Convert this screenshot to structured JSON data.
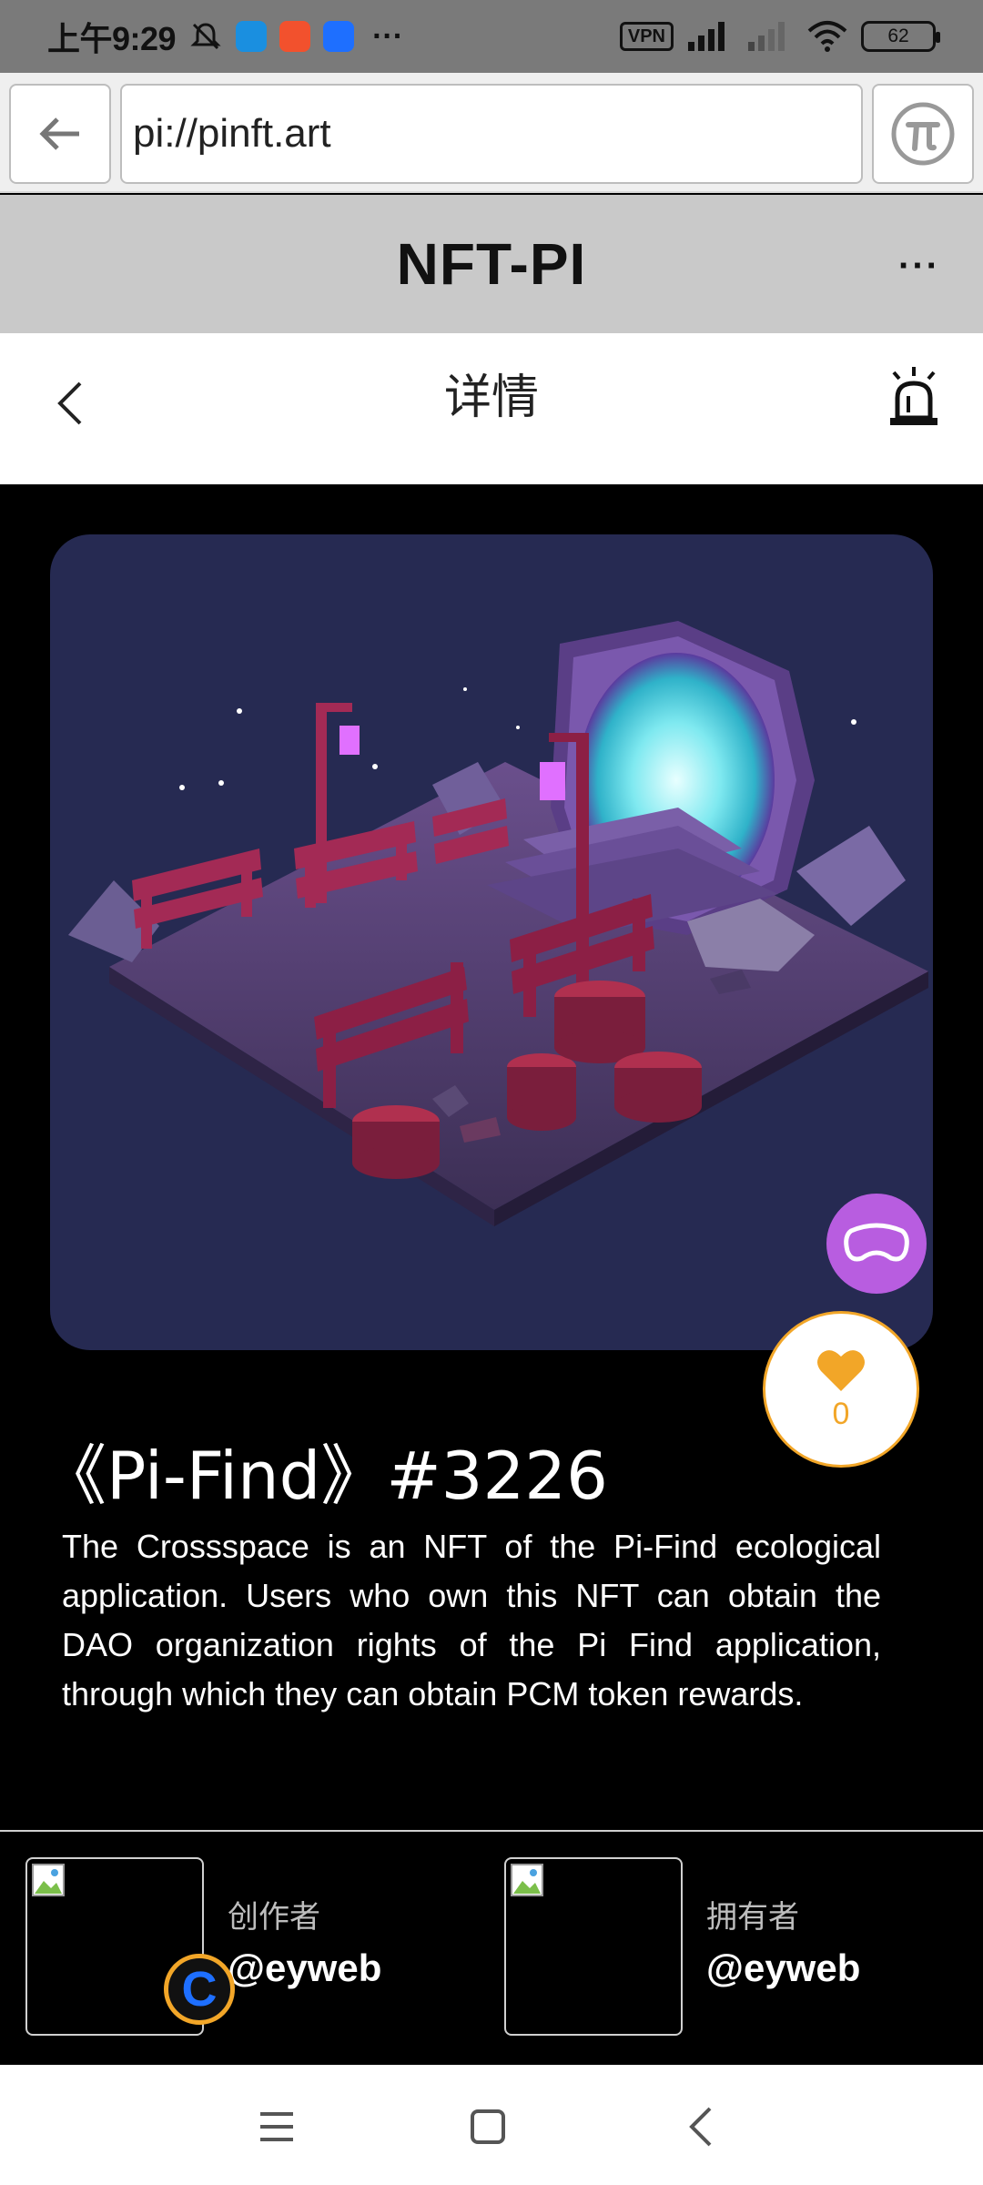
{
  "status_bar": {
    "time": "上午9:29",
    "vpn": "VPN",
    "battery": "62",
    "more": "···",
    "apps": [
      {
        "name": "app-icon-blue",
        "color": "#1a8fe0"
      },
      {
        "name": "app-icon-red",
        "color": "#f2512d"
      },
      {
        "name": "app-icon-flag",
        "color": "#1e6fff"
      }
    ]
  },
  "browser": {
    "url": "pi://pinft.art"
  },
  "header": {
    "title": "NFT-PI",
    "more": "···"
  },
  "nav": {
    "title": "详情"
  },
  "nft": {
    "title": "《Pi-Find》#3226",
    "description": "The Crossspace is an NFT of the Pi-Find ecological application. Users who own this NFT can obtain the DAO organization rights of the Pi Find application, through which they can obtain PCM token rewards.",
    "likes": "0"
  },
  "creator": {
    "role": "创作者",
    "name": "@eyweb"
  },
  "owner": {
    "role": "拥有者",
    "name": "@eyweb"
  },
  "floating_badge": "C",
  "colors": {
    "accent_orange": "#f2a628",
    "vr_purple": "#b85de0",
    "image_bg": "#262a52"
  }
}
